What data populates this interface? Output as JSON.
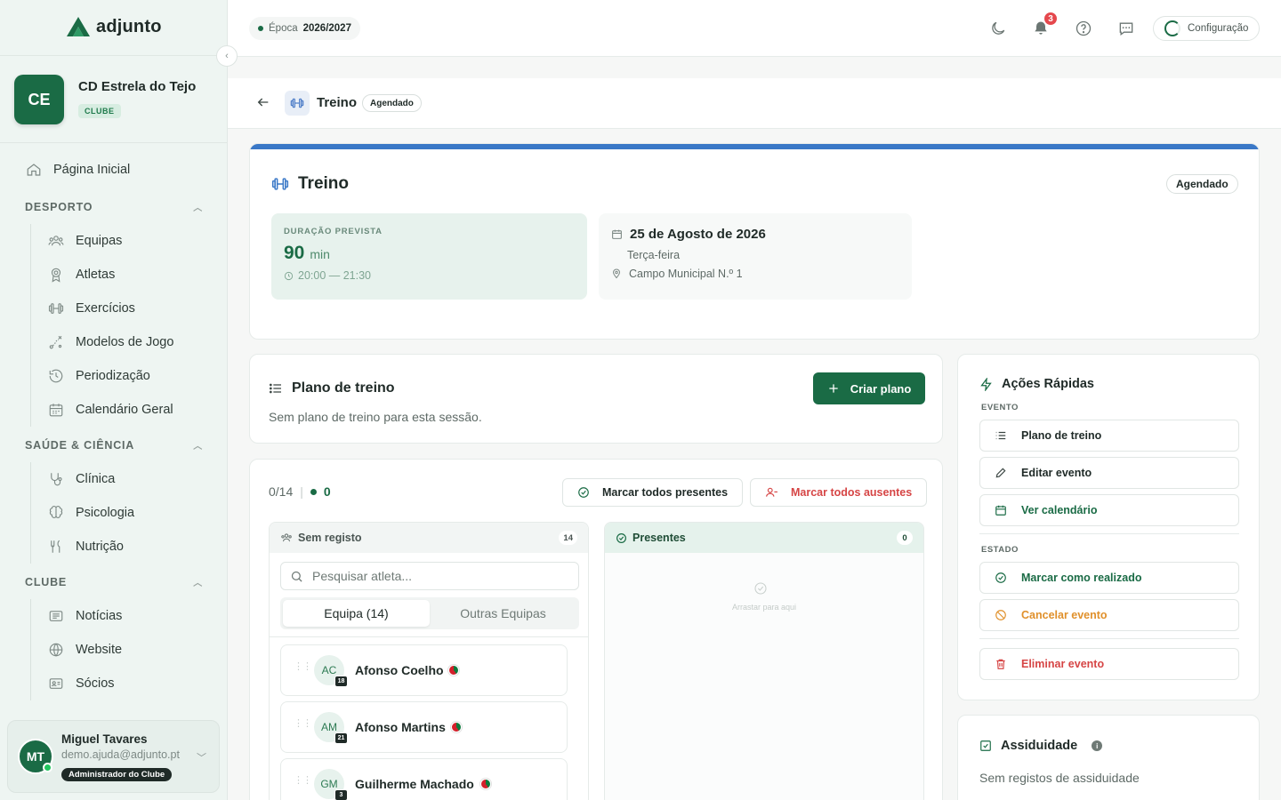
{
  "app": {
    "name": "adjunto"
  },
  "club": {
    "initials": "CE",
    "name": "CD Estrela do Tejo",
    "badge": "CLUBE"
  },
  "nav": {
    "home": "Página Inicial",
    "sections": [
      {
        "label": "DESPORTO",
        "items": [
          "Equipas",
          "Atletas",
          "Exercícios",
          "Modelos de Jogo",
          "Periodização",
          "Calendário Geral"
        ]
      },
      {
        "label": "SAÚDE & CIÊNCIA",
        "items": [
          "Clínica",
          "Psicologia",
          "Nutrição"
        ]
      },
      {
        "label": "CLUBE",
        "items": [
          "Notícias",
          "Website",
          "Sócios"
        ]
      }
    ]
  },
  "user": {
    "initials": "MT",
    "name": "Miguel Tavares",
    "email": "demo.ajuda@adjunto.pt",
    "role": "Administrador do Clube"
  },
  "topbar": {
    "season_label": "Época",
    "season_value": "2026/2027",
    "notifications": "3",
    "config_label": "Configuração"
  },
  "header": {
    "title": "Treino",
    "status": "Agendado"
  },
  "event": {
    "title": "Treino",
    "status": "Agendado",
    "duration_label": "DURAÇÃO PREVISTA",
    "duration_value": "90",
    "duration_unit": "min",
    "time_range": "20:00 — 21:30",
    "date": "25 de Agosto de 2026",
    "weekday": "Terça-feira",
    "location": "Campo Municipal N.º 1"
  },
  "plan": {
    "title": "Plano de treino",
    "empty": "Sem plano de treino para esta sessão.",
    "create_label": "Criar plano"
  },
  "attendance": {
    "count": "0/14",
    "present_count": "0",
    "mark_all_present": "Marcar todos presentes",
    "mark_all_absent": "Marcar todos ausentes",
    "unregistered": {
      "label": "Sem registo",
      "count": "14"
    },
    "present": {
      "label": "Presentes",
      "count": "0",
      "empty": "Arrastar para aqui"
    },
    "search_placeholder": "Pesquisar atleta...",
    "tabs": [
      "Equipa (14)",
      "Outras Equipas"
    ],
    "athletes": [
      {
        "initials": "AC",
        "name": "Afonso Coelho",
        "number": "18"
      },
      {
        "initials": "AM",
        "name": "Afonso Martins",
        "number": "21"
      },
      {
        "initials": "GM",
        "name": "Guilherme Machado",
        "number": "3"
      }
    ]
  },
  "quick_actions": {
    "title": "Ações Rápidas",
    "event_section": "EVENTO",
    "state_section": "ESTADO",
    "event_actions": [
      "Plano de treino",
      "Editar evento",
      "Ver calendário"
    ],
    "mark_done": "Marcar como realizado",
    "cancel": "Cancelar evento",
    "delete": "Eliminar evento",
    "colors": {
      "accent": "#1a6b45",
      "warning": "#e0902b",
      "danger": "#d64545"
    }
  },
  "assiduidade": {
    "title": "Assiduidade",
    "empty": "Sem registos de assiduidade"
  }
}
